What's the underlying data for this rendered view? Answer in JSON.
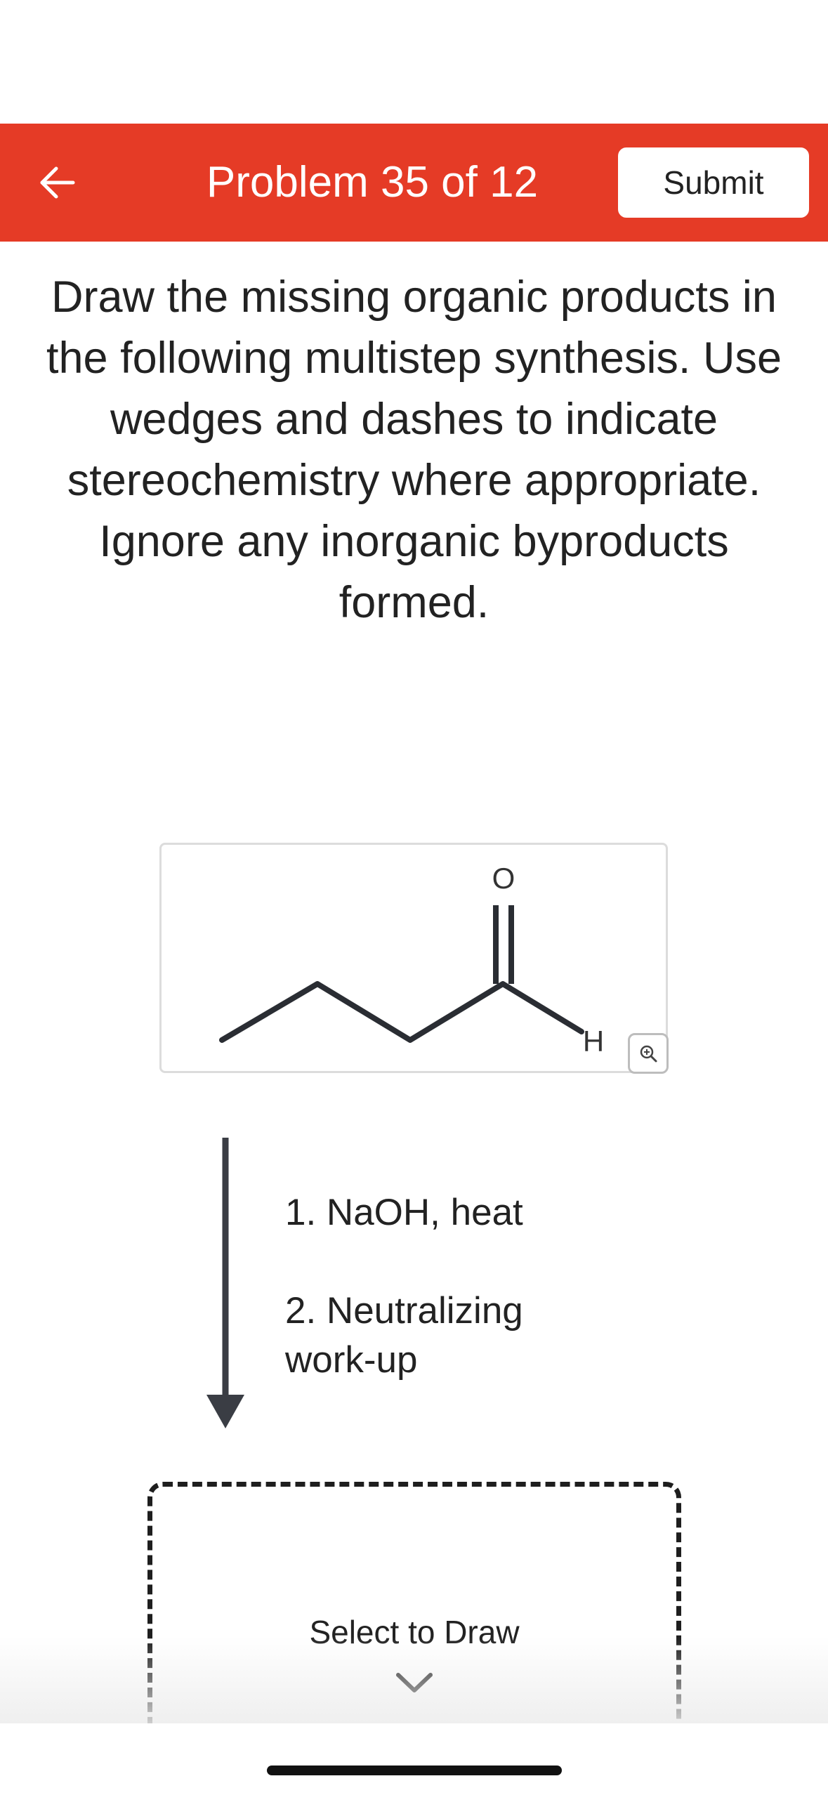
{
  "header": {
    "title": "Problem 35 of 12",
    "submit_label": "Submit",
    "background_color": "#e53b26"
  },
  "question": {
    "text": "Draw the missing organic products in the following multistep synthesis. Use wedges and dashes to indicate stereochemistry where appropriate. Ignore any inorganic byproducts formed."
  },
  "molecule": {
    "oxygen_label": "O",
    "hydrogen_label": "H"
  },
  "conditions": {
    "step1": "1. NaOH, heat",
    "step2": "2. Neutralizing work-up"
  },
  "draw_box": {
    "label": "Select to Draw"
  },
  "icons": {
    "back": "arrow-left-icon",
    "zoom": "zoom-in-icon",
    "chevron": "chevron-down-icon"
  }
}
